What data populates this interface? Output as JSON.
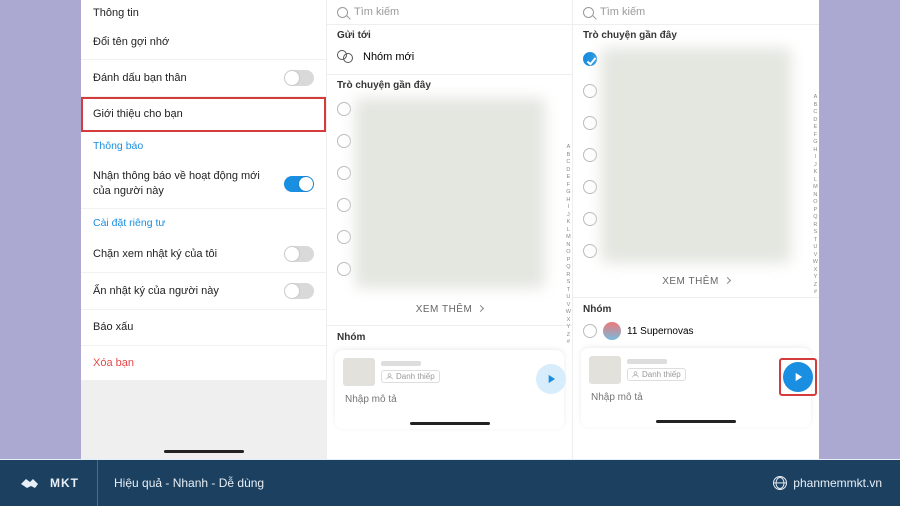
{
  "panel1": {
    "title": "Thông tin",
    "items": {
      "rename": "Đổi tên gợi nhớ",
      "bestfriend": "Đánh dấu bạn thân",
      "introduce": "Giới thiệu cho bạn",
      "notif_header": "Thông báo",
      "notif_activity": "Nhận thông báo về hoạt động mới của người này",
      "privacy_header": "Cài đặt riêng tư",
      "block_diary": "Chặn xem nhật ký của tôi",
      "hide_diary": "Ẩn nhật ký của người này",
      "report": "Báo xấu",
      "remove": "Xóa bạn"
    }
  },
  "search_placeholder": "Tìm kiếm",
  "panel2": {
    "send_to": "Gửi tới",
    "new_group": "Nhóm mới",
    "recent": "Trò chuyện gần đây",
    "see_more": "XEM THÊM",
    "group_section": "Nhóm"
  },
  "panel3": {
    "recent": "Trò chuyện gần đây",
    "see_more": "XEM THÊM",
    "group_section": "Nhóm",
    "group_name": "11 Supernovas"
  },
  "card": {
    "chip": "Danh thiếp",
    "desc_placeholder": "Nhập mô tả"
  },
  "alphabet": [
    "A",
    "B",
    "C",
    "D",
    "E",
    "F",
    "G",
    "H",
    "I",
    "J",
    "K",
    "L",
    "M",
    "N",
    "O",
    "P",
    "Q",
    "R",
    "S",
    "T",
    "U",
    "V",
    "W",
    "X",
    "Y",
    "Z",
    "#"
  ],
  "banner": {
    "logo_text": "MKT",
    "slogan": "Hiệu quả - Nhanh - Dễ dùng",
    "site": "phanmemmkt.vn"
  }
}
